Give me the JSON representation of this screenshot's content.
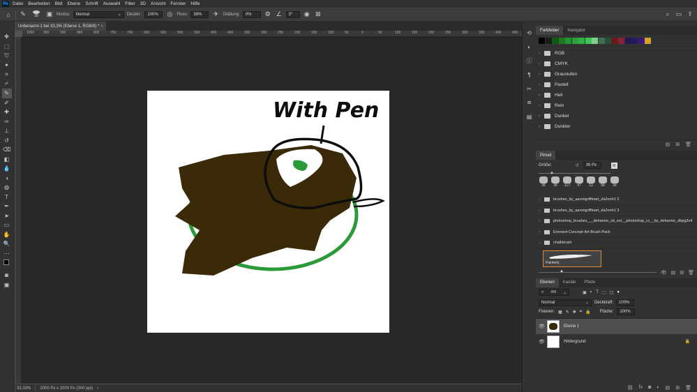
{
  "menu": [
    "Datei",
    "Bearbeiten",
    "Bild",
    "Ebene",
    "Schrift",
    "Auswahl",
    "Filter",
    "3D",
    "Ansicht",
    "Fenster",
    "Hilfe"
  ],
  "options": {
    "brush_size": "36",
    "mode_label": "Modus:",
    "mode_value": "Normal",
    "opacity_label": "Deckkr.:",
    "opacity_value": "100%",
    "flow_label": "Fluss:",
    "flow_value": "38%",
    "smoothing_label": "Glättung:",
    "smoothing_value": "0%",
    "angle_value": "0°"
  },
  "document": {
    "tab_title": "Unbenannt-1 bei 33,3% (Ebene 1, RGB/8) *",
    "ruler_ticks": [
      "1000",
      "950",
      "900",
      "850",
      "800",
      "750",
      "700",
      "650",
      "600",
      "550",
      "500",
      "450",
      "400",
      "350",
      "300",
      "250",
      "200",
      "150",
      "100",
      "50",
      "0",
      "50",
      "100",
      "150",
      "200",
      "250",
      "300",
      "350",
      "400",
      "450"
    ],
    "artwork_text": "With Pen"
  },
  "status": {
    "zoom": "33,33%",
    "doc_size": "2000 Px x 2000 Px (300 ppi)"
  },
  "swatches_panel": {
    "tabs": [
      "Farbfelder",
      "Navigator"
    ],
    "colors": [
      "#000000",
      "#1a1a1a",
      "#0f5a14",
      "#1e7a22",
      "#23952f",
      "#27a23a",
      "#2fb348",
      "#3fc45a",
      "#7fd18a",
      "#3f6e52",
      "#2b4d3b",
      "#6e1a1a",
      "#8a1f3a",
      "#1c1c4e",
      "#2a1860",
      "#38187a",
      "#d8a12a"
    ],
    "folders": [
      "RGB",
      "CMYK",
      "Graustufen",
      "Pastell",
      "Hell",
      "Rein",
      "Dunkel",
      "Dunkler"
    ]
  },
  "brush_panel": {
    "tab": "Pinsel",
    "size_label": "Größe:",
    "size_value": "36 Px",
    "presets": [
      "36",
      "36",
      "117",
      "47",
      "12",
      "58",
      "36"
    ],
    "groups": [
      "brushes_by_aarongriffinart_da2enh1 2",
      "brushes_by_aarongriffinart_da2enh1 3",
      "photoshop_brushes___deharme_oil_set__photoshop_cc__by_deharme_dbpg3v4",
      "Evenant-Concept-Art-Brush-Pack",
      "chalkbrush"
    ],
    "selected_brush": "Painterly"
  },
  "layers_panel": {
    "tabs": [
      "Ebenen",
      "Kanäle",
      "Pfade"
    ],
    "filter_kind": "Art",
    "blend_mode": "Normal",
    "opacity_label": "Deckkraft:",
    "opacity_value": "100%",
    "lock_label": "Fixieren:",
    "fill_label": "Fläche:",
    "fill_value": "100%",
    "layers": [
      {
        "name": "Ebene 1"
      },
      {
        "name": "Hintergrund"
      }
    ]
  }
}
